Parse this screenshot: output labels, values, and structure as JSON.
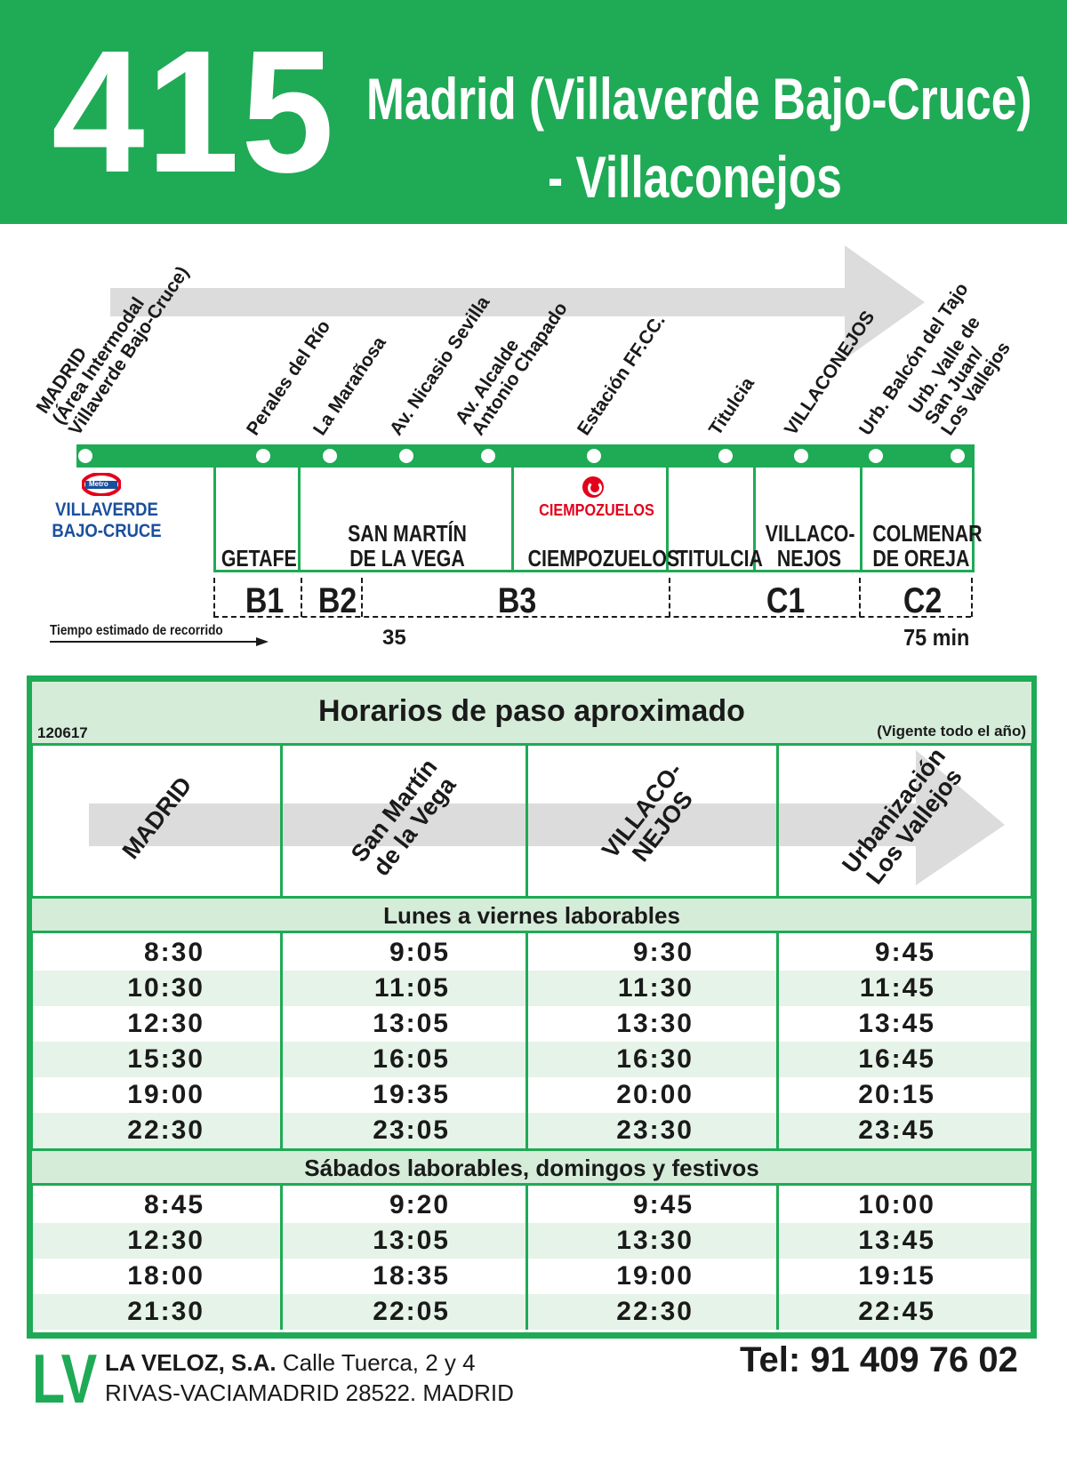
{
  "header": {
    "route_number": "415",
    "route_name_line1": "Madrid (Villaverde Bajo-Cruce)",
    "route_name_line2": "- Villaconejos"
  },
  "stops": [
    [
      "MADRID",
      "(Área Intermodal",
      "Villaverde Bajo-Cruce)"
    ],
    [
      "Perales del Río"
    ],
    [
      "La Marañosa"
    ],
    [
      "Av. Nicasio Sevilla"
    ],
    [
      "Av. Alcalde",
      "Antonio Chapado"
    ],
    [
      "Estación FF.CC."
    ],
    [
      "Titulcia"
    ],
    [
      "VILLACONEJOS"
    ],
    [
      "Urb. Balcón del Tajo"
    ],
    [
      "Urb. Valle de",
      "San Juan/",
      "Los Vallejos"
    ]
  ],
  "metro": {
    "badge": "Metro",
    "station_line1": "VILLAVERDE",
    "station_line2": "BAJO-CRUCE"
  },
  "rail": {
    "station": "CIEMPOZUELOS"
  },
  "municipalities": [
    [
      "GETAFE"
    ],
    [
      "SAN MARTÍN",
      "DE LA VEGA"
    ],
    [
      "CIEMPOZUELOS"
    ],
    [
      "TITULCIA"
    ],
    [
      "VILLACO-",
      "NEJOS"
    ],
    [
      "COLMENAR",
      "DE OREJA"
    ]
  ],
  "zones": [
    "B1",
    "B2",
    "B3",
    "C1",
    "C2"
  ],
  "travel_time": {
    "label": "Tiempo estimado de recorrido",
    "mid": "35",
    "end": "75 min"
  },
  "timetable": {
    "code": "120617",
    "title": "Horarios de paso aproximado",
    "validity": "(Vigente todo el año)",
    "columns": [
      [
        "MADRID"
      ],
      [
        "San Martín",
        "de la Vega"
      ],
      [
        "VILLACO-",
        "NEJOS"
      ],
      [
        "Urbanización",
        "Los Vallejos"
      ]
    ],
    "sections": [
      {
        "title": "Lunes a viernes laborables",
        "rows": [
          [
            "8:30",
            "9:05",
            "9:30",
            "9:45"
          ],
          [
            "10:30",
            "11:05",
            "11:30",
            "11:45"
          ],
          [
            "12:30",
            "13:05",
            "13:30",
            "13:45"
          ],
          [
            "15:30",
            "16:05",
            "16:30",
            "16:45"
          ],
          [
            "19:00",
            "19:35",
            "20:00",
            "20:15"
          ],
          [
            "22:30",
            "23:05",
            "23:30",
            "23:45"
          ]
        ]
      },
      {
        "title": "Sábados laborables, domingos y festivos",
        "rows": [
          [
            "8:45",
            "9:20",
            "9:45",
            "10:00"
          ],
          [
            "12:30",
            "13:05",
            "13:30",
            "13:45"
          ],
          [
            "18:00",
            "18:35",
            "19:00",
            "19:15"
          ],
          [
            "21:30",
            "22:05",
            "22:30",
            "22:45"
          ]
        ]
      }
    ]
  },
  "footer": {
    "logo": "LV",
    "company": "LA VELOZ, S.A.",
    "address1": "Calle Tuerca, 2 y 4",
    "address2": "RIVAS-VACIAMADRID 28522. MADRID",
    "phone": "Tel: 91 409 76 02"
  },
  "colors": {
    "brand_green": "#1faa55",
    "band_green": "#d5ecd9",
    "metro_red": "#e3001b",
    "metro_blue": "#1a4f9c",
    "rail_red": "#e3001b"
  }
}
